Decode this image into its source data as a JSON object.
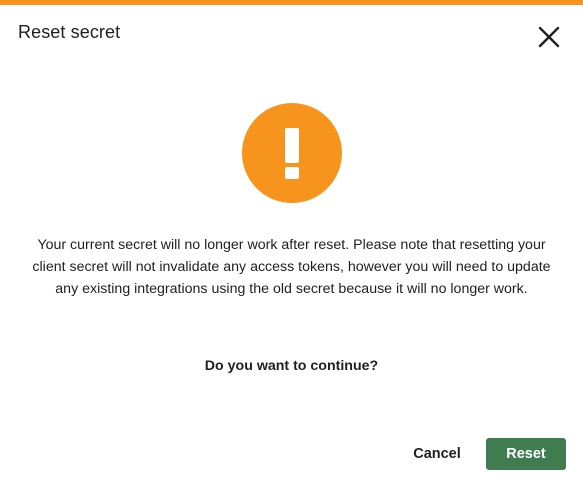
{
  "dialog": {
    "title": "Reset secret",
    "accent_color": "#f7941d",
    "close_icon": "close-icon",
    "warning_icon": "exclamation-circle-icon",
    "warning_color": "#f7941d",
    "message": "Your current secret will no longer work after reset. Please note that resetting your client secret will not invalidate any access tokens, however you will need to update any existing integrations using the old secret because it will no longer work.",
    "question": "Do you want to continue?",
    "cancel_label": "Cancel",
    "reset_label": "Reset",
    "reset_color": "#3f7d51"
  }
}
